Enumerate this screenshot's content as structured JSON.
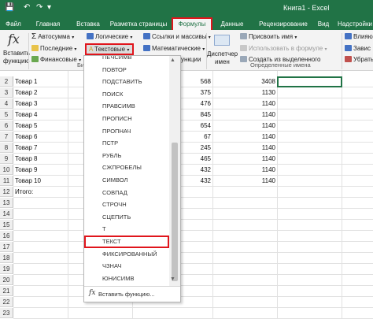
{
  "titlebar": {
    "title": "Книга1 - Excel",
    "save_icon": "save-icon",
    "undo_icon": "undo-icon",
    "redo_icon": "redo-icon"
  },
  "tabs": [
    "Файл",
    "Главная",
    "Вставка",
    "Разметка страницы",
    "Формулы",
    "Данные",
    "Рецензирование",
    "Вид",
    "Надстройки"
  ],
  "active_tab": "Формулы",
  "ribbon": {
    "insert_function_fx": "fx",
    "insert_function_label_1": "Вставить",
    "insert_function_label_2": "функцию",
    "autosum": "Автосумма",
    "recent": "Последние",
    "financial": "Финансовые",
    "logical": "Логические",
    "text_funcs": "Текстовые",
    "lookup": "Ссылки и массивы",
    "math": "Математические",
    "functions_partial": "ункции",
    "name_manager_1": "Диспетчер",
    "name_manager_2": "имен",
    "assign_name": "Присвоить имя",
    "use_in_formula": "Использовать в формуле",
    "create_from_selection": "Создать из выделенного",
    "defined_names_group": "Определенные имена",
    "bi_partial": "Би",
    "trace_1": "Влияю",
    "trace_2": "Завис",
    "trace_3": "Убрать"
  },
  "sheet": {
    "row_numbers": [
      "2",
      "3",
      "4",
      "5",
      "6",
      "7",
      "8",
      "9",
      "10",
      "11",
      "12",
      "13",
      "14",
      "15",
      "16",
      "17",
      "18",
      "19",
      "20",
      "21",
      "22",
      "23"
    ],
    "rows": [
      {
        "name": "Товар 1",
        "qty": "568",
        "sum": "3408"
      },
      {
        "name": "Товар 2",
        "qty": "375",
        "sum": "1130"
      },
      {
        "name": "Товар 3",
        "qty": "476",
        "sum": "1140"
      },
      {
        "name": "Товар 4",
        "qty": "845",
        "sum": "1140"
      },
      {
        "name": "Товар 5",
        "qty": "654",
        "sum": "1140"
      },
      {
        "name": "Товар 6",
        "qty": "67",
        "sum": "1140"
      },
      {
        "name": "Товар 7",
        "qty": "245",
        "sum": "1140"
      },
      {
        "name": "Товар 8",
        "qty": "465",
        "sum": "1140"
      },
      {
        "name": "Товар 9",
        "qty": "432",
        "sum": "1140"
      },
      {
        "name": "Товар 10",
        "qty": "432",
        "sum": "1140"
      }
    ],
    "total_label": "Итого:"
  },
  "dropdown": {
    "items": [
      "ПЕЧСИМВ",
      "ПОВТОР",
      "ПОДСТАВИТЬ",
      "ПОИСК",
      "ПРАВСИМВ",
      "ПРОПИСН",
      "ПРОПНАЧ",
      "ПСТР",
      "РУБЛЬ",
      "СЖПРОБЕЛЫ",
      "СИМВОЛ",
      "СОВПАД",
      "СТРОЧН",
      "СЦЕПИТЬ",
      "Т",
      "ТЕКСТ",
      "ФИКСИРОВАННЫЙ",
      "ЧЗНАЧ",
      "ЮНИСИМВ"
    ],
    "highlighted": "ТЕКСТ",
    "footer_fx": "fx",
    "footer_label": "Вставить функцию..."
  },
  "colors": {
    "excel_green": "#217346",
    "highlight_red": "#e0151c"
  }
}
